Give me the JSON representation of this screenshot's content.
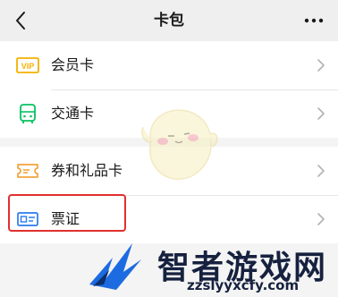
{
  "navbar": {
    "title": "卡包",
    "back_icon": "chevron-left-icon",
    "more_icon": "more-dots-icon"
  },
  "groups": [
    {
      "items": [
        {
          "label": "会员卡",
          "icon": "vip-card-icon",
          "icon_color": "#f5b100"
        },
        {
          "label": "交通卡",
          "icon": "bus-icon",
          "icon_color": "#07c160"
        }
      ]
    },
    {
      "items": [
        {
          "label": "券和礼品卡",
          "icon": "ticket-coupon-icon",
          "icon_color": "#f3a33b"
        },
        {
          "label": "票证",
          "icon": "id-card-icon",
          "icon_color": "#2a7bef"
        }
      ]
    }
  ],
  "annotation": {
    "highlight_color": "#e0302e"
  },
  "watermark": {
    "brand": "智者游戏网",
    "url": "zzslyyxcfy.com"
  }
}
